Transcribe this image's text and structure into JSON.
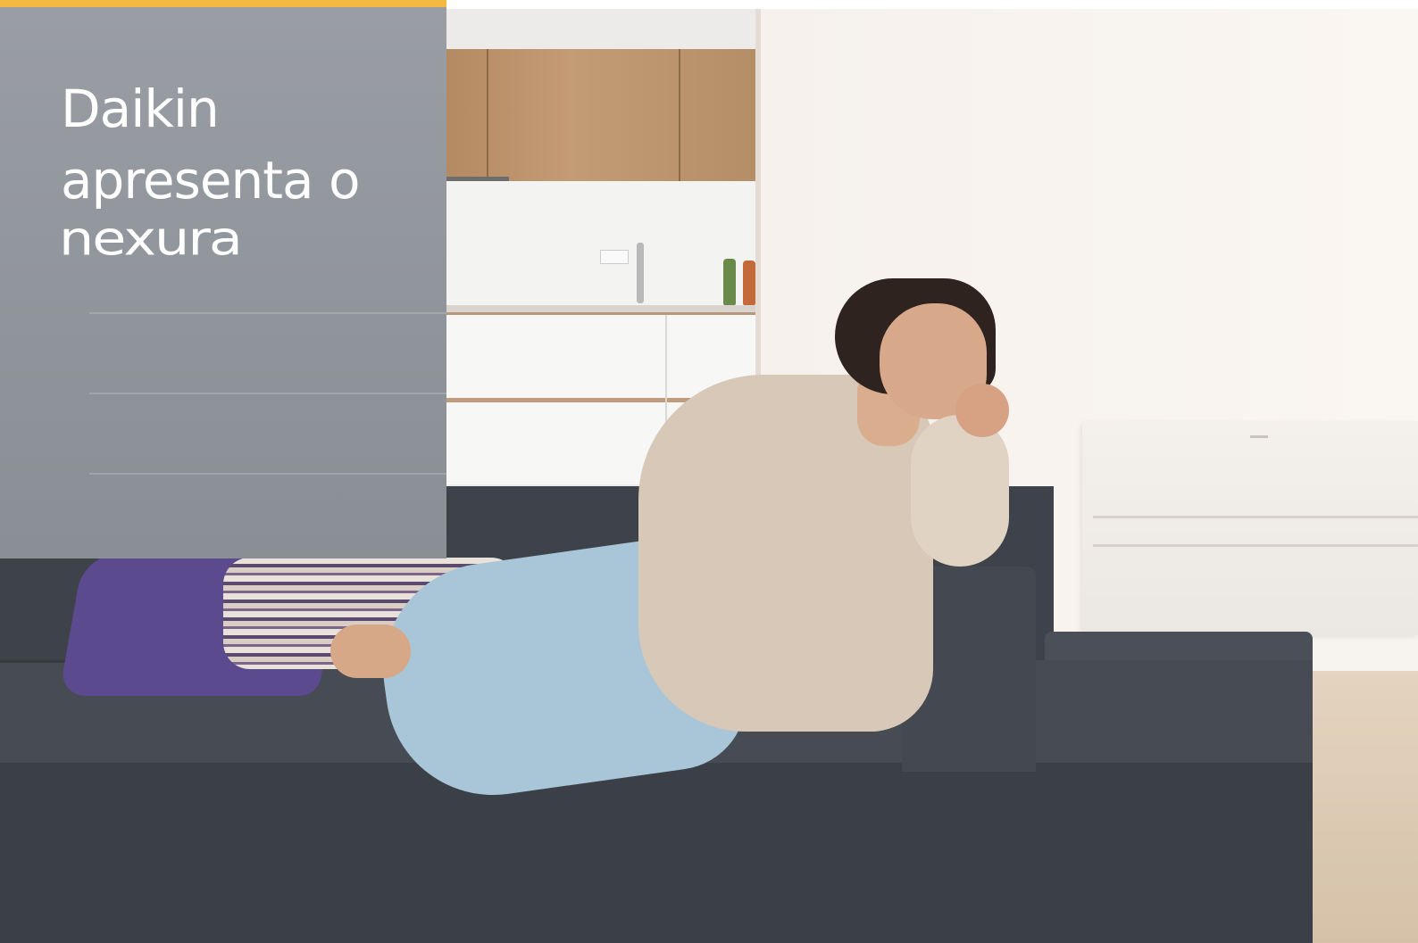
{
  "slide": {
    "accent_color": "#f5b942",
    "panel_color": "#8f9399",
    "headline_line1": "Daikin",
    "headline_line2": "apresenta o",
    "product_name": "nexura"
  }
}
